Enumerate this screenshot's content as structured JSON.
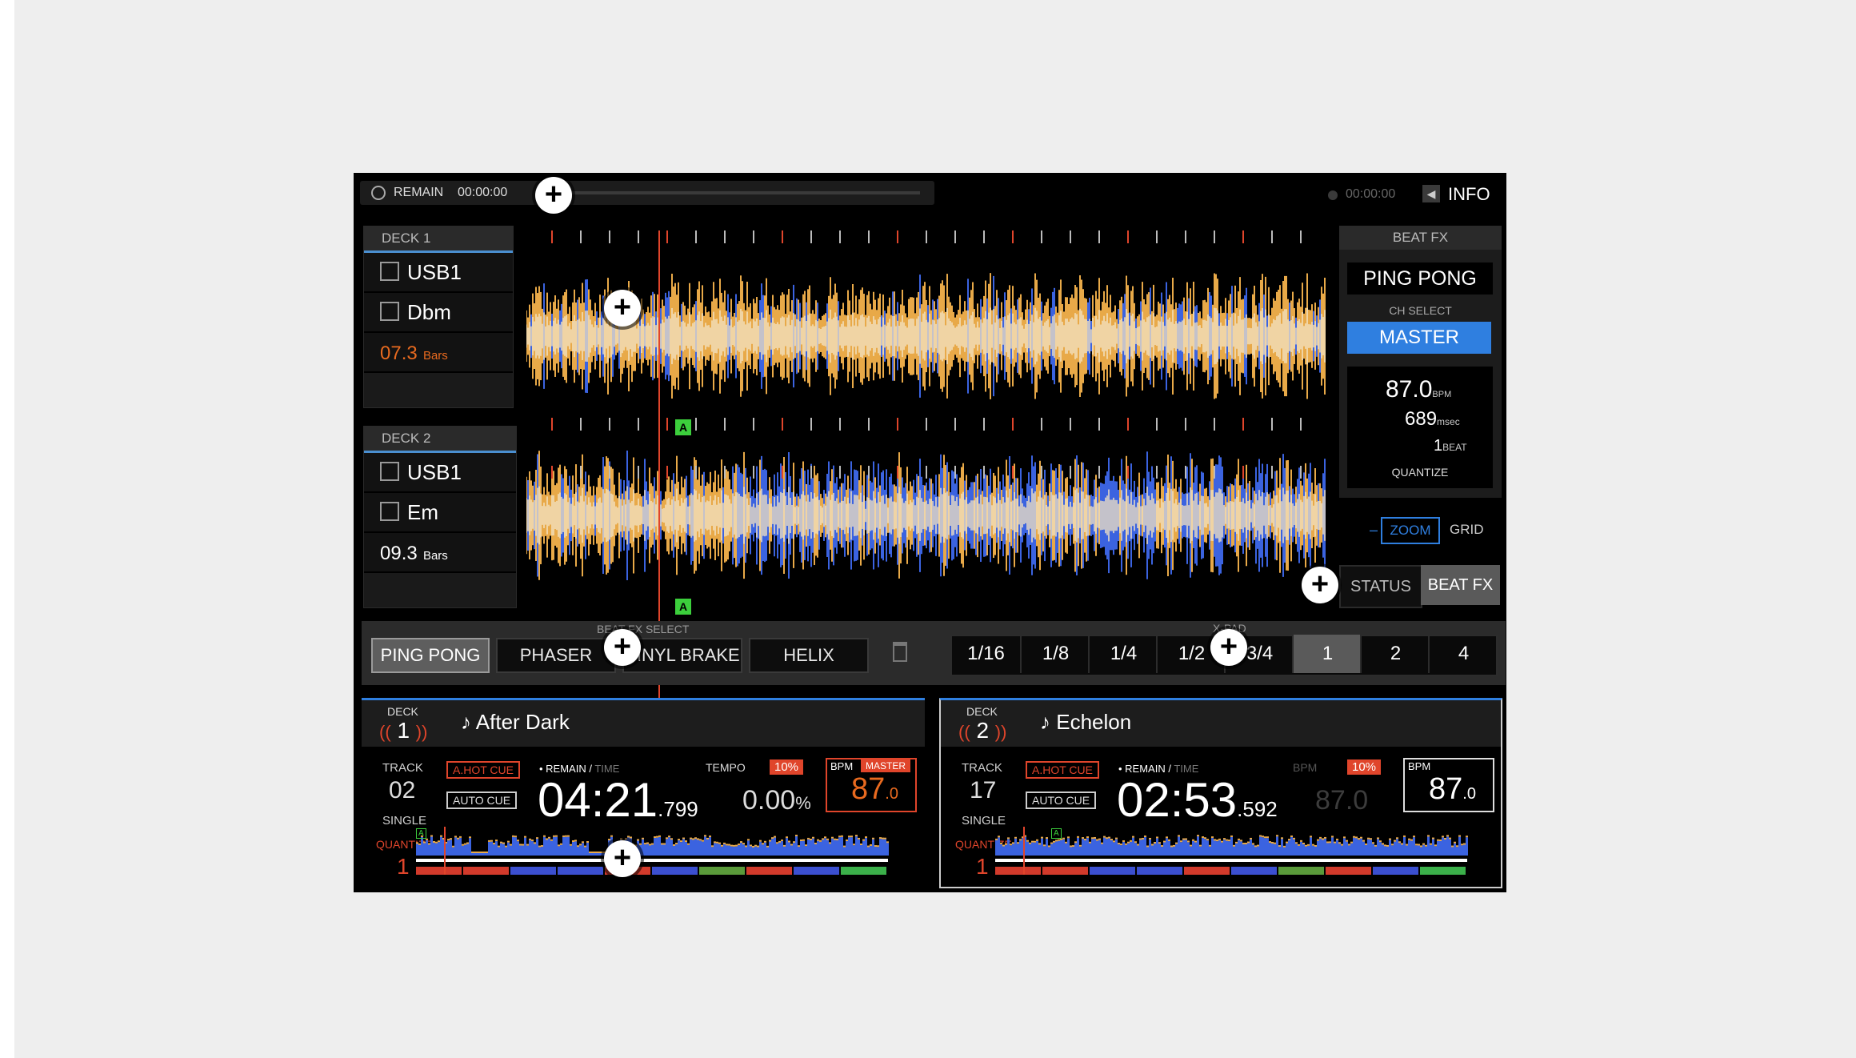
{
  "top": {
    "remain_label": "REMAIN",
    "remain_time": "00:00:00",
    "right_time": "00:00:00",
    "info_label": "INFO"
  },
  "deck1": {
    "tab": "DECK 1",
    "source": "USB1",
    "key": "Dbm",
    "bars_value": "07.3",
    "bars_unit": "Bars"
  },
  "deck2": {
    "tab": "DECK 2",
    "source": "USB1",
    "key": "Em",
    "bars_value": "09.3",
    "bars_unit": "Bars"
  },
  "waveform": {
    "marker1": "A",
    "marker2": "A"
  },
  "beatfx": {
    "header": "BEAT FX",
    "effect_name": "PING PONG",
    "ch_select_label": "CH SELECT",
    "ch_value": "MASTER",
    "bpm_value": "87.0",
    "bpm_unit": "BPM",
    "msec_value": "689",
    "msec_unit": "msec",
    "beat_value": "1",
    "beat_unit": "BEAT",
    "quantize_label": "QUANTIZE",
    "zoom_minus": "–",
    "zoom_label": "ZOOM",
    "grid_label": "GRID",
    "status_tab": "STATUS",
    "beatfx_tab": "BEAT FX"
  },
  "fx_select": {
    "label": "BEAT FX SELECT",
    "items": [
      "PING PONG",
      "PHASER",
      "VINYL BRAKE",
      "HELIX"
    ],
    "selected": "PING PONG"
  },
  "x_pad": {
    "label": "X-PAD",
    "items": [
      "1/16",
      "1/8",
      "1/4",
      "1/2",
      "3/4",
      "1",
      "2",
      "4"
    ],
    "selected": "1"
  },
  "player1": {
    "deck_label": "DECK",
    "deck_num": "1",
    "title": "After Dark",
    "track_label": "TRACK",
    "track_num": "02",
    "mode": "SINGLE",
    "quantize_label": "QUANTIZE",
    "quantize_value": "1",
    "hot_cue": "A.HOT CUE",
    "auto_cue": "AUTO CUE",
    "remain_label": "• REMAIN /",
    "time_label": "TIME",
    "time_main": "04:21",
    "time_ms": ".799",
    "tempo_label": "TEMPO",
    "tempo_range": "10%",
    "tempo_value": "0.00",
    "tempo_unit": "%",
    "bpm_label": "BPM",
    "master_label": "MASTER",
    "bpm_int": "87",
    "bpm_dec": ".0",
    "wave_marker": "A"
  },
  "player2": {
    "deck_label": "DECK",
    "deck_num": "2",
    "title": "Echelon",
    "track_label": "TRACK",
    "track_num": "17",
    "mode": "SINGLE",
    "quantize_label": "QUANTIZE",
    "quantize_value": "1",
    "hot_cue": "A.HOT CUE",
    "auto_cue": "AUTO CUE",
    "remain_label": "• REMAIN /",
    "time_label": "TIME",
    "time_main": "02:53",
    "time_ms": ".592",
    "bpm_dim_label": "BPM",
    "tempo_range": "10%",
    "bpm_dim_value": "87.0",
    "bpm_label": "BPM",
    "bpm_int": "87",
    "bpm_dec": ".0",
    "wave_marker": "A"
  },
  "colors": {
    "accent_blue": "#2f7fe0",
    "hot_orange": "#e86a1f",
    "red": "#e0452b",
    "wave_gold": "#e8a948",
    "wave_blue": "#3b63e0"
  }
}
